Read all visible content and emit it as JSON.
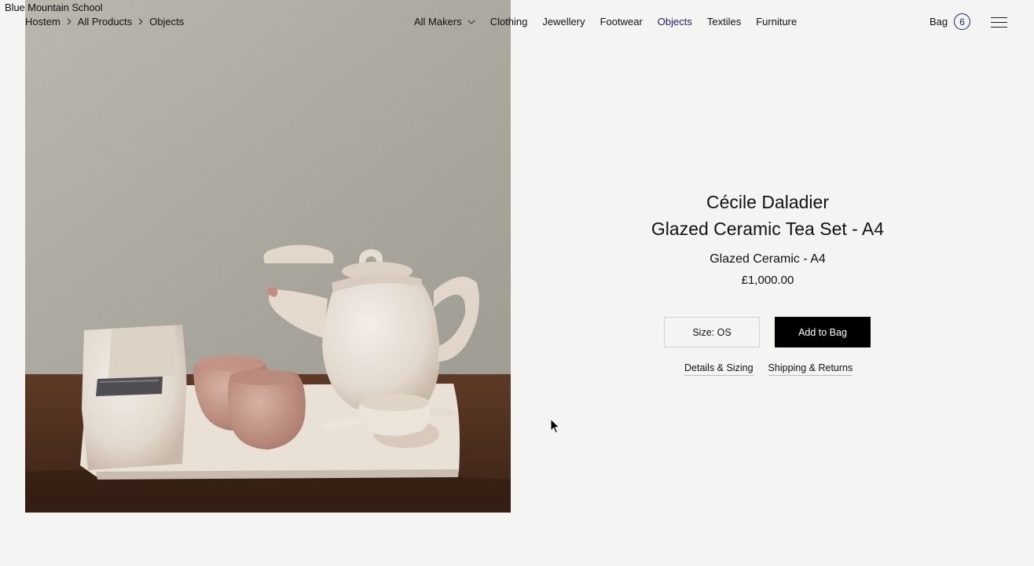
{
  "site": {
    "name": "Blue Mountain School"
  },
  "breadcrumb": [
    "Hostem",
    "All Products",
    "Objects"
  ],
  "nav": {
    "makers_label": "All Makers",
    "items": [
      "Clothing",
      "Jewellery",
      "Footwear",
      "Objects",
      "Textiles",
      "Furniture"
    ],
    "active": "Objects"
  },
  "bag": {
    "label": "Bag",
    "count": "6"
  },
  "product": {
    "maker": "Cécile Daladier",
    "title": "Glazed Ceramic Tea Set - A4",
    "subtitle": "Glazed Ceramic - A4",
    "price": "£1,000.00",
    "size_label": "Size: OS",
    "add_label": "Add to Bag",
    "details_link": "Details & Sizing",
    "shipping_link": "Shipping & Returns"
  },
  "icons": {
    "breadcrumb_separator": "chevron-right-icon",
    "makers_dropdown": "chevron-down-icon",
    "menu": "hamburger-menu-icon",
    "cursor": "mouse-pointer-icon"
  },
  "colors": {
    "accent": "#1d1f6b",
    "background": "#f4f4f3",
    "button": "#000000"
  }
}
